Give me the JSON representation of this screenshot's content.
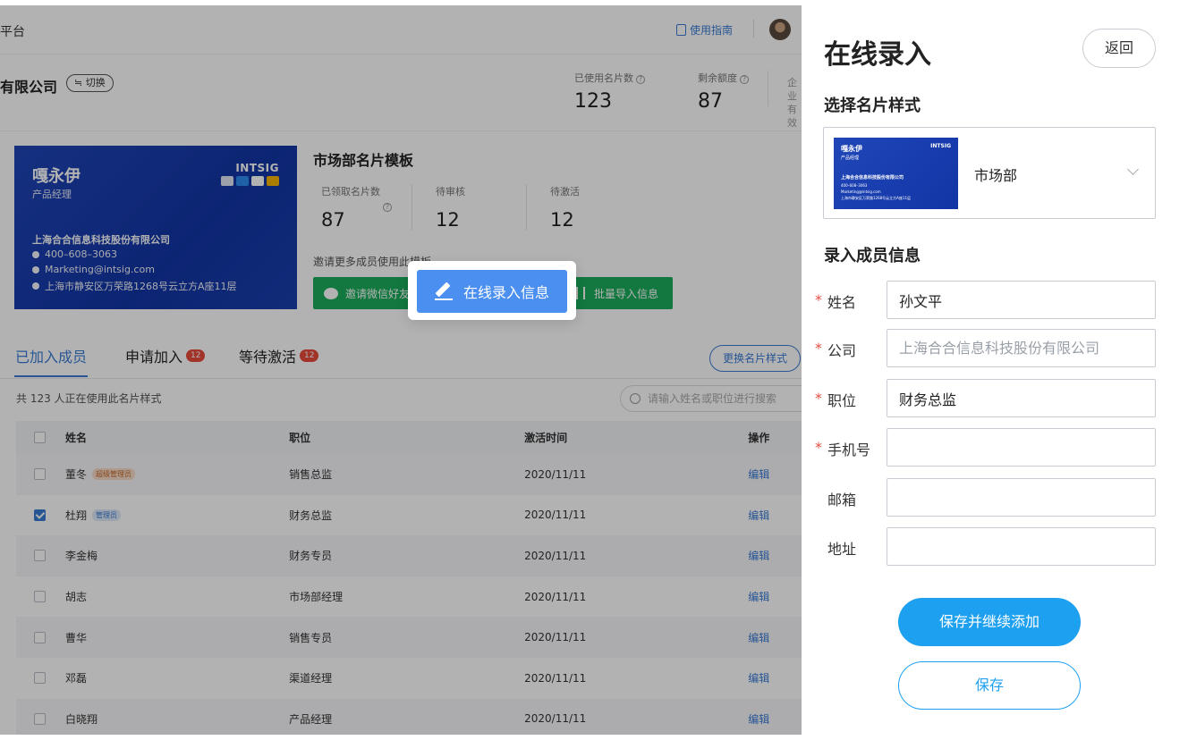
{
  "app": {
    "title_fragment": "平台",
    "guide_label": "使用指南"
  },
  "company": {
    "name": "有限公司",
    "switch_label": "切换",
    "stats": [
      {
        "label": "已使用名片数",
        "value": "123"
      },
      {
        "label": "剩余额度",
        "value": "87"
      }
    ],
    "cut_label_1": "企业",
    "cut_label_2": "有效"
  },
  "template": {
    "title": "市场部名片模板",
    "stats": [
      {
        "label": "已领取名片数",
        "value": "87"
      },
      {
        "label": "待审核",
        "value": "12"
      },
      {
        "label": "待激活",
        "value": "12"
      }
    ],
    "invite_tip": "邀请更多成员使用此模板",
    "wechat_btn": "邀请微信好友",
    "import_btn": "批量导入信息",
    "online_btn": "在线录入信息"
  },
  "card": {
    "name": "嘎永伊",
    "title": "产品经理",
    "brand": "INTSIG",
    "company": "上海合合信息科技股份有限公司",
    "phone": "400–608–3063",
    "email": "Marketing@intsig.com",
    "address": "上海市静安区万荣路1268号云立方A座11层"
  },
  "tabs": [
    {
      "label": "已加入成员",
      "badge": ""
    },
    {
      "label": "申请加入",
      "badge": "12"
    },
    {
      "label": "等待激活",
      "badge": "12"
    }
  ],
  "change_style_btn": "更换名片样式",
  "member_count_tip": "共 123 人正在使用此名片样式",
  "search_placeholder": "请输入姓名或职位进行搜索",
  "table": {
    "headers": [
      "姓名",
      "职位",
      "激活时间",
      "操作"
    ],
    "rows": [
      {
        "name": "董冬",
        "tag": "超级管理员",
        "position": "销售总监",
        "time": "2020/11/11",
        "op": "编辑",
        "checked": false
      },
      {
        "name": "杜翔",
        "tag": "管理员",
        "position": "财务总监",
        "time": "2020/11/11",
        "op": "编辑",
        "checked": true
      },
      {
        "name": "李金梅",
        "tag": "",
        "position": "财务专员",
        "time": "2020/11/11",
        "op": "编辑",
        "checked": false
      },
      {
        "name": "胡志",
        "tag": "",
        "position": "市场部经理",
        "time": "2020/11/11",
        "op": "编辑",
        "checked": false
      },
      {
        "name": "曹华",
        "tag": "",
        "position": "销售专员",
        "time": "2020/11/11",
        "op": "编辑",
        "checked": false
      },
      {
        "name": "邓磊",
        "tag": "",
        "position": "渠道经理",
        "time": "2020/11/11",
        "op": "编辑",
        "checked": false
      },
      {
        "name": "白晓翔",
        "tag": "",
        "position": "产品经理",
        "time": "2020/11/11",
        "op": "编辑",
        "checked": false
      }
    ]
  },
  "panel": {
    "title": "在线录入",
    "back_label": "返回",
    "style_section": "选择名片样式",
    "selected_style": "市场部",
    "member_section": "录入成员信息",
    "fields": [
      {
        "label": "姓名",
        "required": true,
        "value": "孙文平",
        "placeholder": ""
      },
      {
        "label": "公司",
        "required": true,
        "value": "",
        "placeholder": "上海合合信息科技股份有限公司"
      },
      {
        "label": "职位",
        "required": true,
        "value": "财务总监",
        "placeholder": ""
      },
      {
        "label": "手机号",
        "required": true,
        "value": "",
        "placeholder": ""
      },
      {
        "label": "邮箱",
        "required": false,
        "value": "",
        "placeholder": ""
      },
      {
        "label": "地址",
        "required": false,
        "value": "",
        "placeholder": ""
      }
    ],
    "save_continue_label": "保存并继续添加",
    "save_label": "保存"
  },
  "colors": {
    "primary": "#1ea0f0",
    "link": "#3a7bd5",
    "required": "#e54d42",
    "wechat_green": "#1aad5b",
    "card_blue": "#1235a5"
  }
}
